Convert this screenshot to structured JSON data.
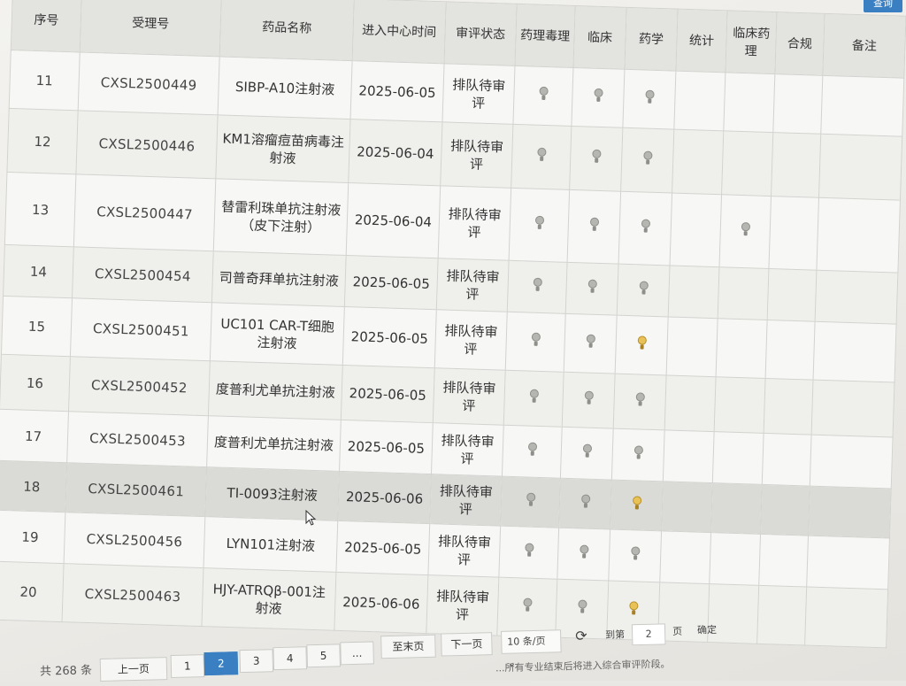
{
  "top_button": "查询",
  "columns": [
    "序号",
    "受理号",
    "药品名称",
    "进入中心时间",
    "审评状态",
    "药理毒理",
    "临床",
    "药学",
    "统计",
    "临床药理",
    "合规",
    "备注"
  ],
  "rows": [
    {
      "seq": "11",
      "acc": "CXSL2500449",
      "name": "SIBP-A10注射液",
      "time": "2025-06-05",
      "status": "排队待审评",
      "bulbs": [
        "off",
        "off",
        "off",
        "",
        "",
        "",
        ""
      ]
    },
    {
      "seq": "12",
      "acc": "CXSL2500446",
      "name": "KM1溶瘤痘苗病毒注射液",
      "time": "2025-06-04",
      "status": "排队待审评",
      "bulbs": [
        "off",
        "off",
        "off",
        "",
        "",
        "",
        ""
      ]
    },
    {
      "seq": "13",
      "acc": "CXSL2500447",
      "name": "替雷利珠单抗注射液（皮下注射）",
      "time": "2025-06-04",
      "status": "排队待审评",
      "bulbs": [
        "off",
        "off",
        "off",
        "",
        "off",
        "",
        ""
      ]
    },
    {
      "seq": "14",
      "acc": "CXSL2500454",
      "name": "司普奇拜单抗注射液",
      "time": "2025-06-05",
      "status": "排队待审评",
      "bulbs": [
        "off",
        "off",
        "off",
        "",
        "",
        "",
        ""
      ]
    },
    {
      "seq": "15",
      "acc": "CXSL2500451",
      "name": "UC101 CAR-T细胞注射液",
      "time": "2025-06-05",
      "status": "排队待审评",
      "bulbs": [
        "off",
        "off",
        "on",
        "",
        "",
        "",
        ""
      ]
    },
    {
      "seq": "16",
      "acc": "CXSL2500452",
      "name": "度普利尤单抗注射液",
      "time": "2025-06-05",
      "status": "排队待审评",
      "bulbs": [
        "off",
        "off",
        "off",
        "",
        "",
        "",
        ""
      ]
    },
    {
      "seq": "17",
      "acc": "CXSL2500453",
      "name": "度普利尤单抗注射液",
      "time": "2025-06-05",
      "status": "排队待审评",
      "bulbs": [
        "off",
        "off",
        "off",
        "",
        "",
        "",
        ""
      ]
    },
    {
      "seq": "18",
      "acc": "CXSL2500461",
      "name": "TI-0093注射液",
      "time": "2025-06-06",
      "status": "排队待审评",
      "bulbs": [
        "off",
        "off",
        "on",
        "",
        "",
        "",
        ""
      ]
    },
    {
      "seq": "19",
      "acc": "CXSL2500456",
      "name": "LYN101注射液",
      "time": "2025-06-05",
      "status": "排队待审评",
      "bulbs": [
        "off",
        "off",
        "off",
        "",
        "",
        "",
        ""
      ]
    },
    {
      "seq": "20",
      "acc": "CXSL2500463",
      "name": "HJY-ATRQβ-001注射液",
      "time": "2025-06-06",
      "status": "排队待审评",
      "bulbs": [
        "off",
        "off",
        "on",
        "",
        "",
        "",
        ""
      ]
    }
  ],
  "highlighted_row": "18",
  "pager": {
    "total": "共 268 条",
    "prev": "上一页",
    "pages": [
      "1",
      "2",
      "3",
      "4",
      "5",
      "..."
    ],
    "current": "2",
    "last": "至末页",
    "next": "下一页",
    "page_size": "10 条/页",
    "goto_label": "到第",
    "goto_value": "2",
    "page_unit": "页",
    "confirm": "确定"
  },
  "notice": "...所有专业结束后将进入综合审评阶段。"
}
